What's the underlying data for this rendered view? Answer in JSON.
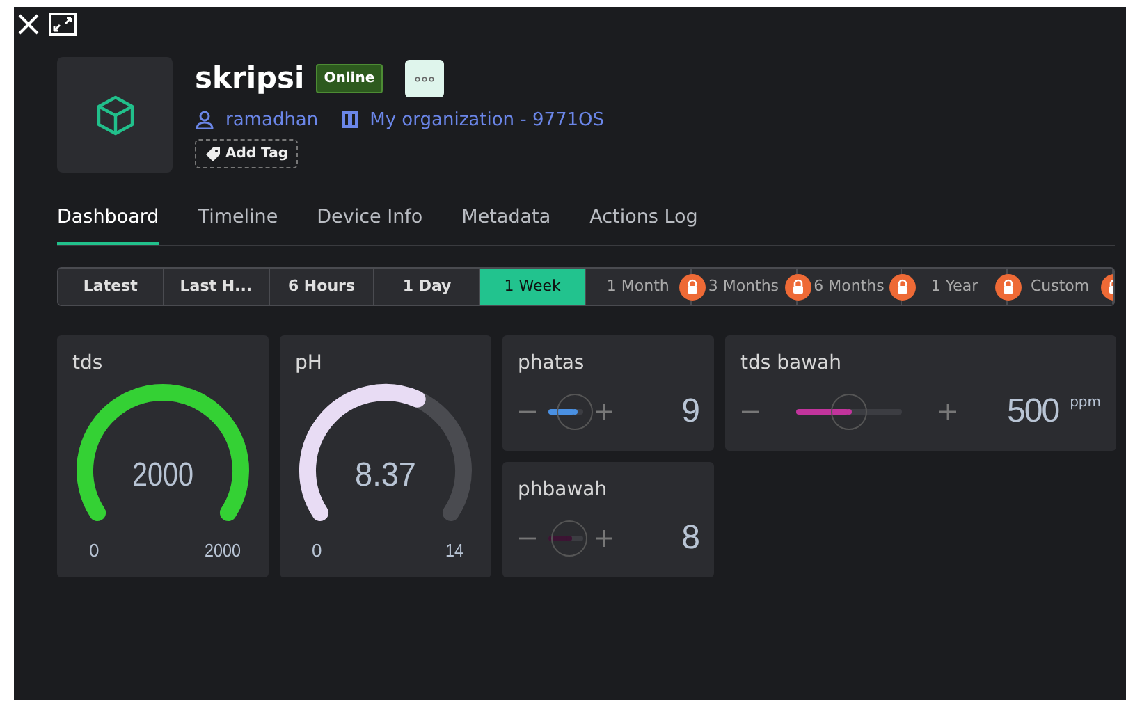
{
  "device": {
    "name": "skripsi",
    "status": "Online",
    "owner": "ramadhan",
    "organization": "My organization - 9771OS",
    "add_tag": "Add Tag"
  },
  "tabs": [
    {
      "label": "Dashboard",
      "selected": true
    },
    {
      "label": "Timeline",
      "selected": false
    },
    {
      "label": "Device Info",
      "selected": false
    },
    {
      "label": "Metadata",
      "selected": false
    },
    {
      "label": "Actions Log",
      "selected": false
    }
  ],
  "time_ranges": [
    {
      "label": "Latest",
      "selected": false,
      "locked": false
    },
    {
      "label": "Last H...",
      "selected": false,
      "locked": false
    },
    {
      "label": "6 Hours",
      "selected": false,
      "locked": false
    },
    {
      "label": "1 Day",
      "selected": false,
      "locked": false
    },
    {
      "label": "1 Week",
      "selected": true,
      "locked": false
    },
    {
      "label": "1 Month",
      "selected": false,
      "locked": true
    },
    {
      "label": "3 Months",
      "selected": false,
      "locked": true
    },
    {
      "label": "6 Months",
      "selected": false,
      "locked": true
    },
    {
      "label": "1 Year",
      "selected": false,
      "locked": true
    },
    {
      "label": "Custom",
      "selected": false,
      "locked": true
    }
  ],
  "widgets": [
    {
      "kind": "gauge",
      "title": "tds",
      "value": "2000",
      "min": "0",
      "max": "2000",
      "color": "#34d134"
    },
    {
      "kind": "gauge",
      "title": "pH",
      "value": "8.37",
      "min": "0",
      "max": "14",
      "color": "#e8dcf4"
    },
    {
      "kind": "slider",
      "title": "phatas",
      "value": "9",
      "level": 0.75,
      "color": "#4a90e2"
    },
    {
      "kind": "slider",
      "title": "tds bawah",
      "value": "500",
      "unit": "ppm",
      "level": 0.5,
      "color": "#c2349c"
    },
    {
      "kind": "slider",
      "title": "phbawah",
      "value": "8",
      "level": 0.6,
      "color": "#3c1433"
    }
  ]
}
